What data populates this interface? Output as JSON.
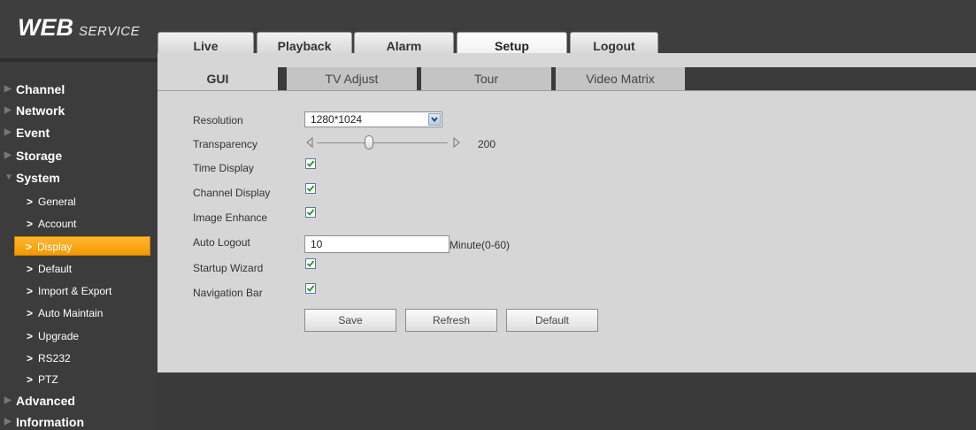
{
  "logo": {
    "bold": "WEB",
    "small": "SERVICE"
  },
  "top_tabs": [
    {
      "label": "Live",
      "active": false
    },
    {
      "label": "Playback",
      "active": false
    },
    {
      "label": "Alarm",
      "active": false
    },
    {
      "label": "Setup",
      "active": true
    },
    {
      "label": "Logout",
      "active": false
    }
  ],
  "sidebar": {
    "channel": "Channel",
    "network": "Network",
    "event": "Event",
    "storage": "Storage",
    "system": "System",
    "system_items": [
      {
        "label": "General",
        "active": false
      },
      {
        "label": "Account",
        "active": false
      },
      {
        "label": "Display",
        "active": true
      },
      {
        "label": "Default",
        "active": false
      },
      {
        "label": "Import & Export",
        "active": false
      },
      {
        "label": "Auto Maintain",
        "active": false
      },
      {
        "label": "Upgrade",
        "active": false
      },
      {
        "label": "RS232",
        "active": false
      },
      {
        "label": "PTZ",
        "active": false
      }
    ],
    "advanced": "Advanced",
    "information": "Information",
    "expand_icon": "right-triangle-icon",
    "collapse_icon": "down-triangle-icon",
    "sub_icon": "chevron-right-icon"
  },
  "sub_tabs": [
    {
      "label": "GUI",
      "active": true
    },
    {
      "label": "TV Adjust",
      "active": false
    },
    {
      "label": "Tour",
      "active": false
    },
    {
      "label": "Video Matrix",
      "active": false
    }
  ],
  "form": {
    "resolution_label": "Resolution",
    "resolution_value": "1280*1024",
    "transparency_label": "Transparency",
    "transparency_value": "200",
    "transparency_level": 0.4,
    "time_display_label": "Time Display",
    "time_display_checked": true,
    "channel_display_label": "Channel Display",
    "channel_display_checked": true,
    "image_enhance_label": "Image Enhance",
    "image_enhance_checked": true,
    "auto_logout_label": "Auto Logout",
    "auto_logout_value": "10",
    "auto_logout_unit": "Minute(0-60)",
    "startup_wizard_label": "Startup Wizard",
    "startup_wizard_checked": true,
    "navigation_bar_label": "Navigation Bar",
    "navigation_bar_checked": true
  },
  "buttons": {
    "save": "Save",
    "refresh": "Refresh",
    "default": "Default"
  },
  "colors": {
    "accent": "#f5a000",
    "background": "#3a3a3a",
    "panel": "#d6d6d6",
    "check": "#2f8f2f"
  }
}
